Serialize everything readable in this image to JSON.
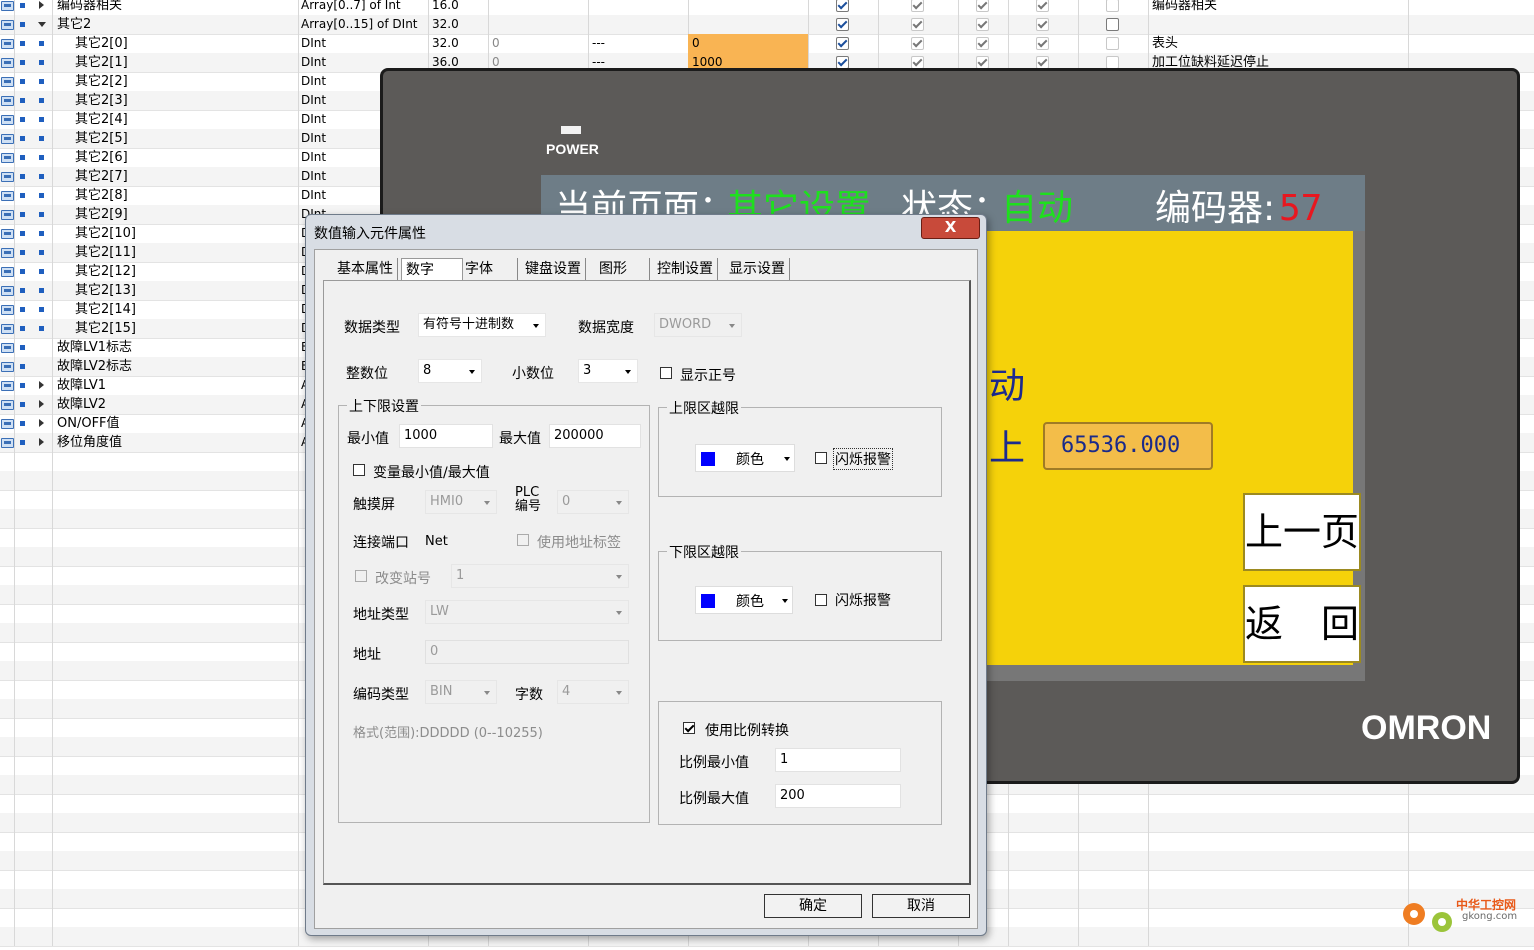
{
  "table": {
    "rows": [
      {
        "name": "编码器相关",
        "type": "Array[0..7] of Int",
        "offset": "16.0",
        "start": "",
        "retain": "",
        "setpoint": "",
        "checks": [
          true,
          true,
          true,
          true
        ],
        "extra": false,
        "comment": "编码器相关",
        "kind": "tri-bullet",
        "indent": 0
      },
      {
        "name": "其它2",
        "type": "Array[0..15] of DInt",
        "offset": "32.0",
        "start": "",
        "retain": "",
        "setpoint": "",
        "checks": [
          true,
          true,
          true,
          true
        ],
        "extra": false,
        "comment": "",
        "kind": "open",
        "indent": 0
      },
      {
        "name": "其它2[0]",
        "type": "DInt",
        "offset": "32.0",
        "start": "0",
        "retain": "---",
        "setpoint": "0",
        "checks": [
          true,
          true,
          true,
          true
        ],
        "extra": false,
        "comment": "表头",
        "kind": "item",
        "indent": 1,
        "orange": true
      },
      {
        "name": "其它2[1]",
        "type": "DInt",
        "offset": "36.0",
        "start": "0",
        "retain": "---",
        "setpoint": "1000",
        "checks": [
          true,
          true,
          true,
          true
        ],
        "extra": false,
        "comment": "加工位缺料延迟停止",
        "kind": "item",
        "indent": 1,
        "orange": true
      },
      {
        "name": "其它2[2]",
        "type": "DInt",
        "offset": "",
        "start": "",
        "retain": "",
        "setpoint": "",
        "checks": [],
        "extra": false,
        "comment": "",
        "kind": "item",
        "indent": 1
      },
      {
        "name": "其它2[3]",
        "type": "DInt",
        "offset": "",
        "start": "",
        "retain": "",
        "setpoint": "",
        "checks": [],
        "extra": false,
        "comment": "",
        "kind": "item",
        "indent": 1
      },
      {
        "name": "其它2[4]",
        "type": "DInt",
        "kind": "item",
        "indent": 1
      },
      {
        "name": "其它2[5]",
        "type": "DInt",
        "kind": "item",
        "indent": 1
      },
      {
        "name": "其它2[6]",
        "type": "DInt",
        "kind": "item",
        "indent": 1
      },
      {
        "name": "其它2[7]",
        "type": "DInt",
        "kind": "item",
        "indent": 1
      },
      {
        "name": "其它2[8]",
        "type": "DInt",
        "kind": "item",
        "indent": 1
      },
      {
        "name": "其它2[9]",
        "type": "DInt",
        "kind": "item",
        "indent": 1
      },
      {
        "name": "其它2[10]",
        "type": "D",
        "kind": "item",
        "indent": 1
      },
      {
        "name": "其它2[11]",
        "type": "D",
        "kind": "item",
        "indent": 1
      },
      {
        "name": "其它2[12]",
        "type": "D",
        "kind": "item",
        "indent": 1
      },
      {
        "name": "其它2[13]",
        "type": "D",
        "kind": "item",
        "indent": 1
      },
      {
        "name": "其它2[14]",
        "type": "D",
        "kind": "item",
        "indent": 1
      },
      {
        "name": "其它2[15]",
        "type": "D",
        "kind": "item",
        "indent": 1
      },
      {
        "name": "故障LV1标志",
        "type": "B",
        "kind": "bullet",
        "indent": 0
      },
      {
        "name": "故障LV2标志",
        "type": "B",
        "kind": "bullet",
        "indent": 0
      },
      {
        "name": "故障LV1",
        "type": "A",
        "kind": "tri",
        "indent": 0
      },
      {
        "name": "故障LV2",
        "type": "A",
        "kind": "tri",
        "indent": 0
      },
      {
        "name": "ON/OFF值",
        "type": "A",
        "kind": "tri",
        "indent": 0
      },
      {
        "name": "移位角度值",
        "type": "A",
        "kind": "tri",
        "indent": 0
      }
    ]
  },
  "hmi": {
    "power_label": "POWER",
    "header_page_label": "当前页面：",
    "header_page_value": "其它设置",
    "header_state_label": "状态：",
    "header_state_value": "自动",
    "header_encoder_label": "编码器:",
    "header_encoder_value": "57",
    "partial_text_1": "动",
    "partial_text_2": "上",
    "value_display": "65536.000",
    "btn_prev": "上一页",
    "btn_back": "返　回",
    "brand": "OMRON",
    "colors": {
      "header_green": "#1ee01e",
      "header_white": "#ffffff",
      "encoder_red": "#e8171f",
      "screen_yellow": "#f5d20a"
    }
  },
  "dialog": {
    "title": "数值输入元件属性",
    "close_label": "X",
    "tabs": [
      "基本属性",
      "数字",
      "字体",
      "键盘设置",
      "图形",
      "控制设置",
      "显示设置"
    ],
    "active_tab": "数字",
    "data_type_label": "数据类型",
    "data_type_value": "有符号十进制数",
    "data_width_label": "数据宽度",
    "data_width_value": "DWORD",
    "int_digits_label": "整数位",
    "int_digits_value": "8",
    "dec_digits_label": "小数位",
    "dec_digits_value": "3",
    "show_sign_label": "显示正号",
    "limits_group": "上下限设置",
    "min_label": "最小值",
    "min_value": "1000",
    "max_label": "最大值",
    "max_value": "200000",
    "var_minmax_label": "变量最小值/最大值",
    "touch_label": "触摸屏",
    "touch_value": "HMI0",
    "plc_label_1": "PLC",
    "plc_label_2": "编号",
    "plc_value": "0",
    "port_label": "连接端口",
    "port_value": "Net",
    "use_addr_tag_label": "使用地址标签",
    "change_station_label": "改变站号",
    "station_value": "1",
    "addr_type_label": "地址类型",
    "addr_type_value": "LW",
    "addr_label": "地址",
    "addr_value": "0",
    "code_type_label": "编码类型",
    "code_type_value": "BIN",
    "word_count_label": "字数",
    "word_count_value": "4",
    "format_text": "格式(范围):DDDDD (0--10255)",
    "upper_group": "上限区越限",
    "lower_group": "下限区越限",
    "color_label": "颜色",
    "flash_alarm_label": "闪烁报警",
    "swatch_color": "#0000ff",
    "use_scale_label": "使用比例转换",
    "scale_min_label": "比例最小值",
    "scale_min_value": "1",
    "scale_max_label": "比例最大值",
    "scale_max_value": "200",
    "ok_label": "确定",
    "cancel_label": "取消"
  },
  "watermark": {
    "line1": "中华工控网",
    "line2": "gkong.com"
  }
}
